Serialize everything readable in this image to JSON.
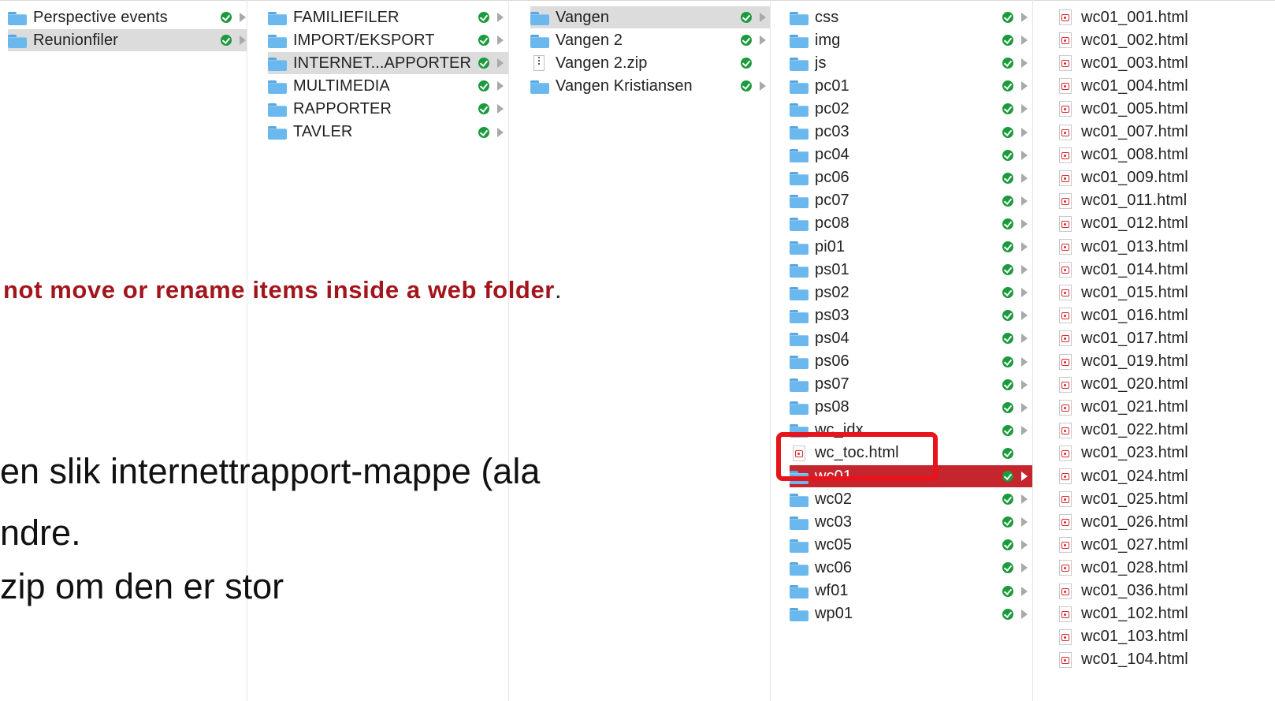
{
  "column1": {
    "items": [
      {
        "label": "Perspective events",
        "kind": "folder",
        "selected": false
      },
      {
        "label": "Reunionfiler",
        "kind": "folder",
        "selected": true
      }
    ]
  },
  "column2": {
    "items": [
      {
        "label": "FAMILIEFILER",
        "kind": "folder",
        "selected": false
      },
      {
        "label": "IMPORT/EKSPORT",
        "kind": "folder",
        "selected": false
      },
      {
        "label": "INTERNET...APPORTER",
        "kind": "folder",
        "selected": true
      },
      {
        "label": "MULTIMEDIA",
        "kind": "folder",
        "selected": false
      },
      {
        "label": "RAPPORTER",
        "kind": "folder",
        "selected": false
      },
      {
        "label": "TAVLER",
        "kind": "folder",
        "selected": false
      }
    ]
  },
  "column3": {
    "items": [
      {
        "label": "Vangen",
        "kind": "folder",
        "selected": true
      },
      {
        "label": "Vangen 2",
        "kind": "folder",
        "selected": false
      },
      {
        "label": "Vangen 2.zip",
        "kind": "zip",
        "selected": false
      },
      {
        "label": "Vangen Kristiansen",
        "kind": "folder",
        "selected": false
      }
    ]
  },
  "column4": {
    "items": [
      {
        "label": "css",
        "kind": "folder"
      },
      {
        "label": "img",
        "kind": "folder"
      },
      {
        "label": "js",
        "kind": "folder"
      },
      {
        "label": "pc01",
        "kind": "folder"
      },
      {
        "label": "pc02",
        "kind": "folder"
      },
      {
        "label": "pc03",
        "kind": "folder"
      },
      {
        "label": "pc04",
        "kind": "folder"
      },
      {
        "label": "pc06",
        "kind": "folder"
      },
      {
        "label": "pc07",
        "kind": "folder"
      },
      {
        "label": "pc08",
        "kind": "folder"
      },
      {
        "label": "pi01",
        "kind": "folder"
      },
      {
        "label": "ps01",
        "kind": "folder"
      },
      {
        "label": "ps02",
        "kind": "folder"
      },
      {
        "label": "ps03",
        "kind": "folder"
      },
      {
        "label": "ps04",
        "kind": "folder"
      },
      {
        "label": "ps06",
        "kind": "folder"
      },
      {
        "label": "ps07",
        "kind": "folder"
      },
      {
        "label": "ps08",
        "kind": "folder"
      },
      {
        "label": "wc_idx",
        "kind": "folder"
      },
      {
        "label": "wc_toc.html",
        "kind": "html"
      },
      {
        "label": "wc01",
        "kind": "folder",
        "selected": true
      },
      {
        "label": "wc02",
        "kind": "folder"
      },
      {
        "label": "wc03",
        "kind": "folder"
      },
      {
        "label": "wc05",
        "kind": "folder"
      },
      {
        "label": "wc06",
        "kind": "folder"
      },
      {
        "label": "wf01",
        "kind": "folder"
      },
      {
        "label": "wp01",
        "kind": "folder"
      }
    ]
  },
  "column5": {
    "items": [
      "wc01_001.html",
      "wc01_002.html",
      "wc01_003.html",
      "wc01_004.html",
      "wc01_005.html",
      "wc01_007.html",
      "wc01_008.html",
      "wc01_009.html",
      "wc01_011.html",
      "wc01_012.html",
      "wc01_013.html",
      "wc01_014.html",
      "wc01_015.html",
      "wc01_016.html",
      "wc01_017.html",
      "wc01_019.html",
      "wc01_020.html",
      "wc01_021.html",
      "wc01_022.html",
      "wc01_023.html",
      "wc01_024.html",
      "wc01_025.html",
      "wc01_026.html",
      "wc01_027.html",
      "wc01_028.html",
      "wc01_036.html",
      "wc01_102.html",
      "wc01_103.html",
      "wc01_104.html"
    ]
  },
  "overlay": {
    "warning_text": "not move or rename items inside a web folder",
    "warning_period": ".",
    "bullet_lines": [
      "en slik internettrapport-mappe (ala",
      "ndre.",
      "zip om den er stor"
    ]
  },
  "colors": {
    "status_ok": "#1d9a3d",
    "selection_red": "#c5252c",
    "selection_gray": "#dcdcdc",
    "warning_text": "#a3151c",
    "callout_border": "#e8141b",
    "folder_blue": "#6ab8ee"
  },
  "icons": {
    "folder": "folder-icon",
    "html": "html-file-icon",
    "zip": "zip-file-icon",
    "status": "synced-check-icon",
    "chevron": "chevron-right-icon"
  }
}
